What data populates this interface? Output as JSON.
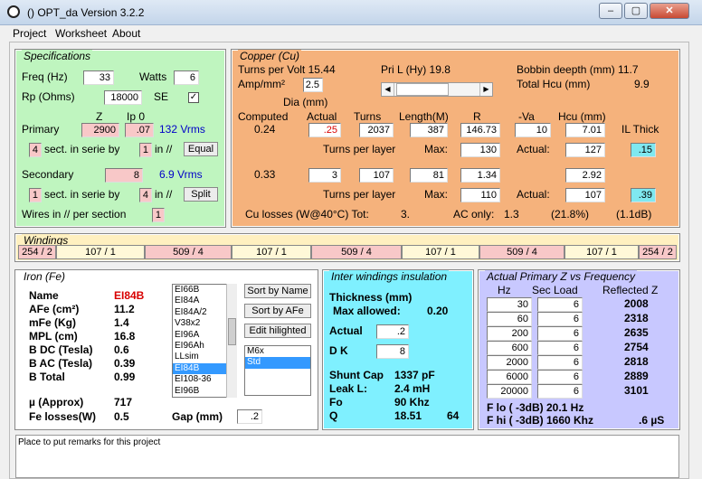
{
  "window": {
    "title": "()  OPT_da Version 3.2.2",
    "controls": [
      "‒",
      "▢",
      "✕"
    ]
  },
  "menu": [
    "Project",
    "Worksheet",
    "About"
  ],
  "specs": {
    "title": "Specifications",
    "freq_label": "Freq (Hz)",
    "freq": "33",
    "watts_label": "Watts",
    "watts": "6",
    "rp_label": "Rp (Ohms)",
    "rp": "18000",
    "se_label": "SE",
    "se_checked": "✓",
    "z_header": "Z",
    "ip0_header": "Ip 0",
    "primary_label": "Primary",
    "primary_z": "2900",
    "primary_ip0": ".07",
    "primary_vrms": "132 Vrms",
    "p_sect": "4",
    "sect_text": "sect. in serie by",
    "p_par": "1",
    "par_text": "in //",
    "equal_button": "Equal",
    "secondary_label": "Secondary",
    "secondary_z": "8",
    "secondary_vrms": "6.9 Vrms",
    "s_sect": "1",
    "s_par": "4",
    "split_button": "Split",
    "wires_label": "Wires in // per section",
    "wires": "1"
  },
  "copper": {
    "title": "Copper (Cu)",
    "tpv_label": "Turns per Volt  15.44",
    "amp_label": "Amp/mm²",
    "amp": "2.5",
    "pril_label": "Pri L (Hy)  19.8",
    "bobbin_label": "Bobbin deepth (mm)  11.7",
    "hcu_label": "Total Hcu (mm)",
    "hcu": "9.9",
    "dia_header": "Dia (mm)",
    "computed_header": "Computed",
    "actual_header": "Actual",
    "turns_header": "Turns",
    "length_header": "Length(M)",
    "r_header": "R",
    "va_header": "-Va",
    "hcu_header": "Hcu (mm)",
    "ilthick_header": "IL Thick",
    "p_computed": "0.24",
    "p_actual": ".25",
    "p_turns": "2037",
    "p_length": "387",
    "p_r": "146.73",
    "p_va": "10",
    "p_hcu": "7.01",
    "tpl_label": "Turns per layer",
    "max_label": "Max:",
    "p_max": "130",
    "actual_label": "Actual:",
    "p_tpl_actual": "127",
    "p_il": ".15",
    "s_computed": "0.33",
    "s_actual": "3",
    "s_turns": "107",
    "s_length": "81",
    "s_r": "1.34",
    "s_hcu": "2.92",
    "s_max": "110",
    "s_tpl_actual": "107",
    "s_il": ".39",
    "losses_label": "Cu losses (W@40°C) Tot:",
    "losses_tot": "3.",
    "ac_label": "AC only:",
    "ac_only": "1.3",
    "ac_pct": "(21.8%)",
    "ac_db": "(1.1dB)"
  },
  "windings": {
    "title": "Windings",
    "cells": [
      "254 / 2",
      "107 / 1",
      "509 / 4",
      "107 / 1",
      "509 / 4",
      "107 / 1",
      "509 / 4",
      "107 / 1",
      "254 / 2"
    ]
  },
  "iron": {
    "title": "Iron (Fe)",
    "name_label": "Name",
    "name": "EI84B",
    "afe_label": "AFe (cm²)",
    "afe": "11.2",
    "mfe_label": "mFe (Kg)",
    "mfe": "1.4",
    "mpl_label": "MPL (cm)",
    "mpl": "16.8",
    "bdc_label": "B DC (Tesla)",
    "bdc": "0.6",
    "bac_label": "B AC (Tesla)",
    "bac": "0.39",
    "btot_label": "B Total",
    "btot": "0.99",
    "mu_label": "µ (Approx)",
    "mu": "717",
    "fel_label": "Fe losses(W)",
    "fel": "0.5",
    "gap_label": "Gap (mm)",
    "gap": ".2",
    "cores": [
      "EI66B",
      "EI84A",
      "EI84A/2",
      "V38x2",
      "EI96A",
      "EI96Ah",
      "LLsim",
      "EI84B",
      "EI108-36",
      "EI96B"
    ],
    "sort_name": "Sort by Name",
    "sort_afe": "Sort by AFe",
    "edit_hl": "Edit hilighted",
    "materials": [
      "M6x",
      "Std"
    ]
  },
  "insulation": {
    "title": "Inter windings insulation",
    "thick_label": "Thickness (mm)",
    "max_allowed_label": "Max allowed:",
    "max_allowed": "0.20",
    "actual_label": "Actual",
    "actual": ".2",
    "dk_label": "D K",
    "dk": "8",
    "shunt_label": "Shunt Cap",
    "shunt": "1337 pF",
    "leak_label": "Leak L:",
    "leak": "2.4 mH",
    "fo_label": "Fo",
    "fo": "90 Khz",
    "q_label": "Q",
    "q": "18.51",
    "q2": "64"
  },
  "zfreq": {
    "title": "Actual Primary Z vs Frequency",
    "hz_header": "Hz",
    "sec_header": "Sec Load",
    "refl_header": "Reflected Z",
    "rows": [
      {
        "hz": "30",
        "load": "6",
        "z": "2008"
      },
      {
        "hz": "60",
        "load": "6",
        "z": "2318"
      },
      {
        "hz": "200",
        "load": "6",
        "z": "2635"
      },
      {
        "hz": "600",
        "load": "6",
        "z": "2754"
      },
      {
        "hz": "2000",
        "load": "6",
        "z": "2818"
      },
      {
        "hz": "6000",
        "load": "6",
        "z": "2889"
      },
      {
        "hz": "20000",
        "load": "6",
        "z": "3101"
      }
    ],
    "flo_label": "F lo ( -3dB) 20.1 Hz",
    "fhi_label": "F hi ( -3dB) 1660 Khz",
    "rise": ".6 µS"
  },
  "remarks": {
    "text": "Place to put remarks for this project"
  },
  "colors": {
    "specs_bg": "#bff5bf",
    "copper_bg": "#f5b27c",
    "windings_bg": "#fff0c0",
    "insul_bg": "#7ff0ff",
    "zfreq_bg": "#c8c8ff",
    "field_pink": "#f8c8c8",
    "field_cyan": "#7fe8f0"
  }
}
